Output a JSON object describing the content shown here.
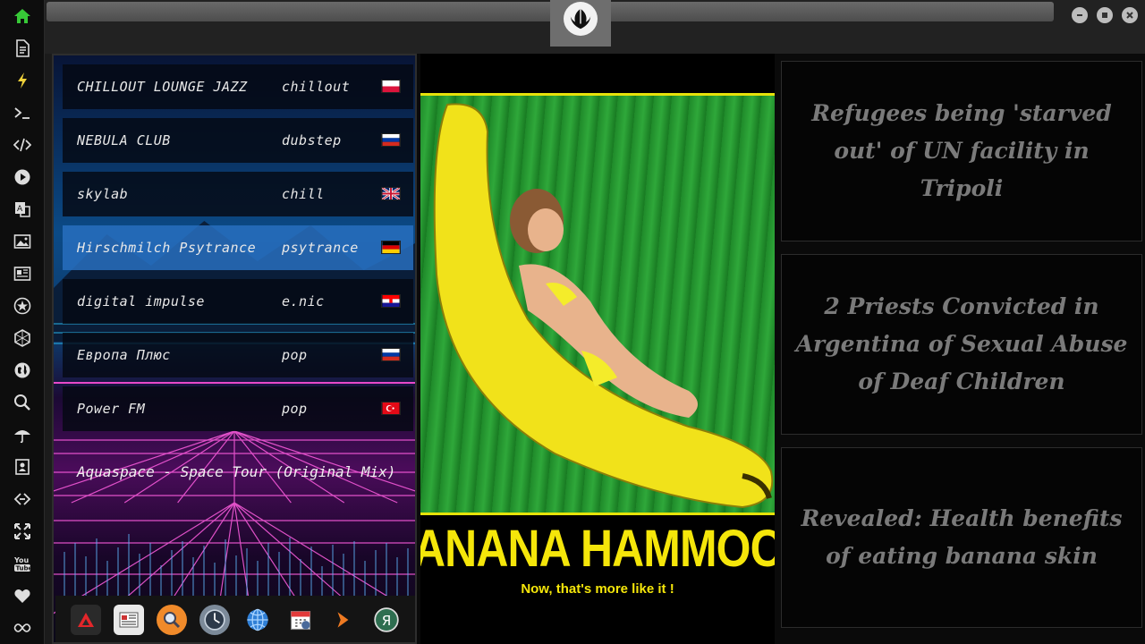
{
  "sidebar": {
    "icons": [
      "home-icon",
      "document-icon",
      "lightning-icon",
      "terminal-icon",
      "code-icon",
      "play-icon",
      "translate-icon",
      "image-icon",
      "news-icon",
      "settings-star-icon",
      "hexagon-icon",
      "globe-icon",
      "search-icon",
      "umbrella-icon",
      "contact-card-icon",
      "link-icon",
      "expand-icon",
      "youtube-icon",
      "heart-icon",
      "infinity-icon"
    ],
    "accent": "#37c837"
  },
  "window": {
    "logo_icon": "rebel-alliance-icon",
    "buttons": [
      "minimize-icon",
      "maximize-icon",
      "close-icon"
    ]
  },
  "radio": {
    "stations": [
      {
        "name": "CHILLOUT LOUNGE JAZZ",
        "genre": "chillout",
        "flag": "poland"
      },
      {
        "name": "NEBULA CLUB",
        "genre": "dubstep",
        "flag": "russia"
      },
      {
        "name": "skylab",
        "genre": "chill",
        "flag": "uk"
      },
      {
        "name": "Hirschmilch Psytrance",
        "genre": "psytrance",
        "flag": "germany"
      },
      {
        "name": "digital impulse",
        "genre": "e.nic",
        "flag": "croatia"
      },
      {
        "name": "Европа Плюс",
        "genre": "pop",
        "flag": "russia"
      },
      {
        "name": "Power FM",
        "genre": "pop",
        "flag": "turkey"
      }
    ],
    "active_index": 3,
    "now_playing": "Aquaspace - Space Tour (Original Mix)",
    "dock": [
      "arrow-app-icon",
      "newspaper-app-icon",
      "search-app-icon",
      "clock-app-icon",
      "globe-app-icon",
      "calendar-app-icon",
      "arrow-right-app-icon",
      "yandex-app-icon"
    ]
  },
  "image": {
    "banner": "ANANA HAMMOCK",
    "subline": "Now, that's more like it !"
  },
  "news": {
    "items": [
      "Refugees being 'starved out' of UN facility in Tripoli",
      "2 Priests Convicted in Argentina of Sexual Abuse of Deaf Children",
      "Revealed: Health benefits of eating banana skin"
    ]
  }
}
